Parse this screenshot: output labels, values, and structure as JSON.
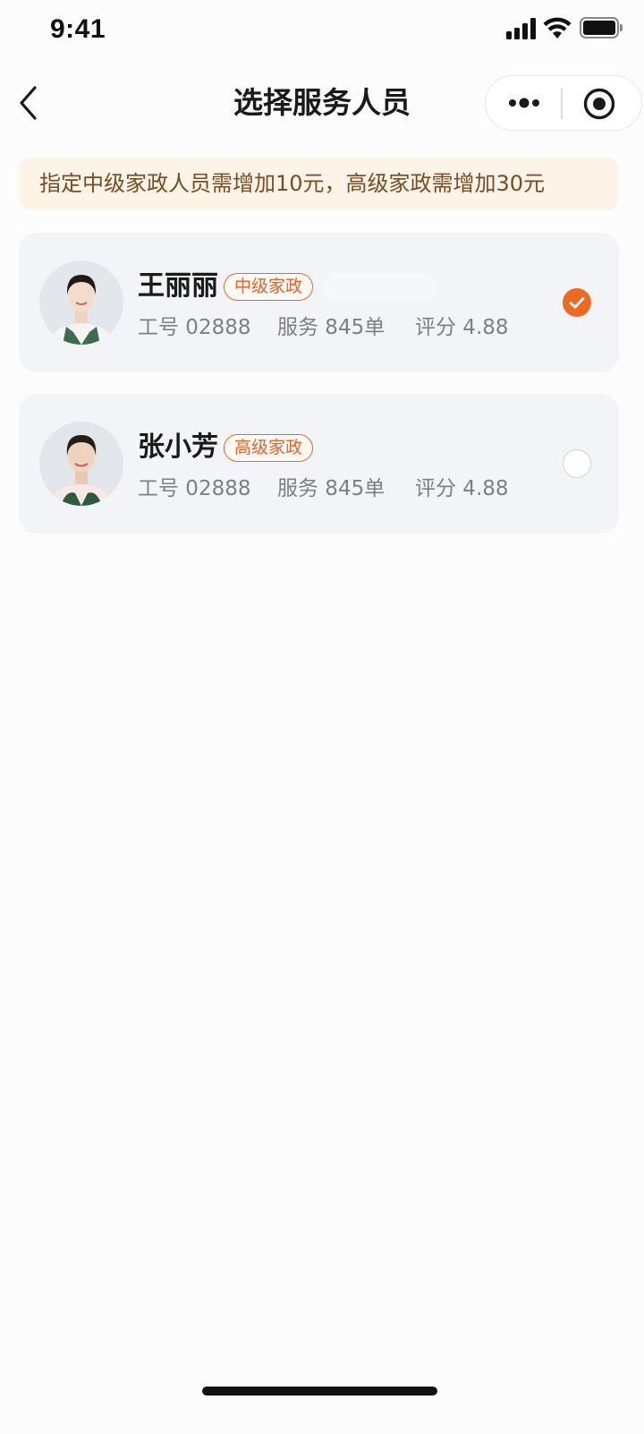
{
  "status_bar": {
    "time": "9:41"
  },
  "nav": {
    "title": "选择服务人员"
  },
  "notice": {
    "text": "指定中级家政人员需增加10元，高级家政需增加30元"
  },
  "workers": [
    {
      "name": "王丽丽",
      "level": "中级家政",
      "id_text": "工号 02888",
      "service_text": "服务 845单",
      "rating_text": "评分 4.88",
      "selected": true
    },
    {
      "name": "张小芳",
      "level": "高级家政",
      "id_text": "工号 02888",
      "service_text": "服务 845单",
      "rating_text": "评分 4.88",
      "selected": false
    }
  ],
  "colors": {
    "accent": "#ec6a26",
    "notice_bg": "#fcf4e6",
    "notice_text": "#7a4b22",
    "card_bg": "#f3f4f8"
  }
}
